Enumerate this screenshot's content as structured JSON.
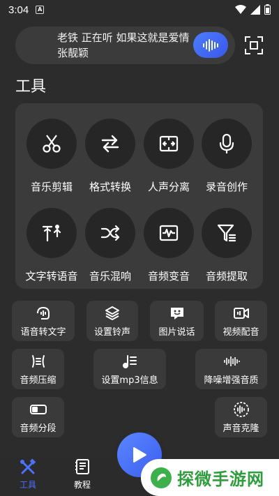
{
  "status_bar": {
    "time": "3:04",
    "notification_letter": "A",
    "icons": [
      "wifi-icon",
      "signal-icon",
      "battery-icon"
    ]
  },
  "now_playing": {
    "text": "老铁 正在听 如果这就是爱情 张靓颖",
    "action_icon": "sound-wave-icon"
  },
  "section": {
    "title": "工具"
  },
  "tools": [
    {
      "label": "音乐剪辑",
      "icon": "scissors-icon"
    },
    {
      "label": "格式转换",
      "icon": "swap-arrows-icon"
    },
    {
      "label": "人声分离",
      "icon": "split-icon"
    },
    {
      "label": "录音创作",
      "icon": "microphone-icon"
    },
    {
      "label": "文字转语音",
      "icon": "text-to-speech-icon"
    },
    {
      "label": "音乐混响",
      "icon": "shuffle-icon"
    },
    {
      "label": "音频变音",
      "icon": "waveform-box-icon"
    },
    {
      "label": "音频提取",
      "icon": "filter-icon"
    }
  ],
  "chips": [
    {
      "label": "语音转文字",
      "icon": "voice-text-icon"
    },
    {
      "label": "设置铃声",
      "icon": "layers-icon"
    },
    {
      "label": "图片说话",
      "icon": "chat-face-icon"
    },
    {
      "label": "视频配音",
      "icon": "video-mic-icon"
    },
    {
      "label": "音频压缩",
      "icon": "compress-icon"
    },
    {
      "label": "设置mp3信息",
      "icon": "music-list-icon"
    },
    {
      "label": "降噪增强音质",
      "icon": "equalizer-icon"
    },
    {
      "label": "音频分段",
      "icon": "segment-icon"
    },
    {
      "label": "声音克隆",
      "icon": "clone-wave-icon"
    }
  ],
  "bottom_nav": {
    "items": [
      {
        "label": "工具",
        "icon": "tools-icon",
        "active": true
      },
      {
        "label": "教程",
        "icon": "book-icon",
        "active": false
      }
    ],
    "play_icon": "play-icon"
  },
  "watermark": {
    "text": "探微手游网"
  },
  "colors": {
    "accent": "#4a72ff",
    "background": "#2c2c2c",
    "panel": "#3b3b3b",
    "watermark_green": "#2e9e3c"
  }
}
